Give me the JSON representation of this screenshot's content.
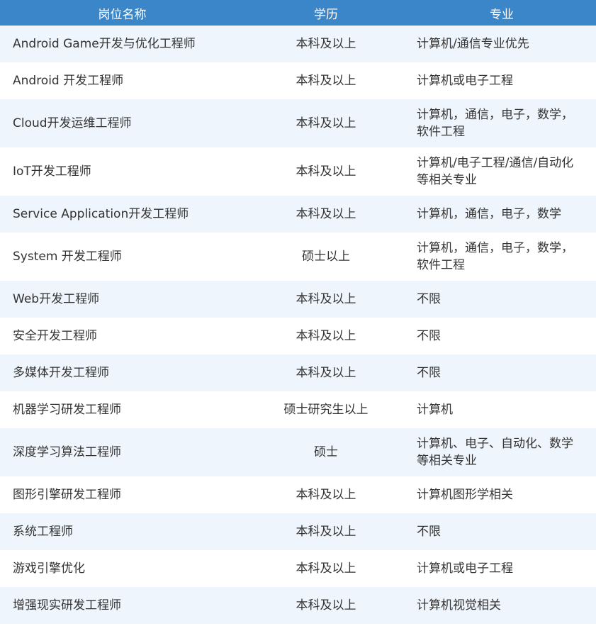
{
  "colors": {
    "header_bg": "#3a86c8",
    "header_text": "#ffffff",
    "row_odd_bg": "#eef5fc",
    "row_even_bg": "#ffffff",
    "body_text": "#333333"
  },
  "table": {
    "headers": [
      "岗位名称",
      "学历",
      "专业"
    ],
    "rows": [
      {
        "name": "Android Game开发与优化工程师",
        "education": "本科及以上",
        "major": "计算机/通信专业优先"
      },
      {
        "name": "Android 开发工程师",
        "education": "本科及以上",
        "major": "计算机或电子工程"
      },
      {
        "name": "Cloud开发运维工程师",
        "education": "本科及以上",
        "major": "计算机，通信，电子，数学，软件工程"
      },
      {
        "name": "IoT开发工程师",
        "education": "本科及以上",
        "major": "计算机/电子工程/通信/自动化等相关专业"
      },
      {
        "name": "Service Application开发工程师",
        "education": "本科及以上",
        "major": "计算机，通信，电子，数学"
      },
      {
        "name": "System 开发工程师",
        "education": "硕士以上",
        "major": "计算机，通信，电子，数学，软件工程"
      },
      {
        "name": "Web开发工程师",
        "education": "本科及以上",
        "major": "不限"
      },
      {
        "name": "安全开发工程师",
        "education": "本科及以上",
        "major": "不限"
      },
      {
        "name": "多媒体开发工程师",
        "education": "本科及以上",
        "major": "不限"
      },
      {
        "name": "机器学习研发工程师",
        "education": "硕士研究生以上",
        "major": "计算机"
      },
      {
        "name": "深度学习算法工程师",
        "education": "硕士",
        "major": "计算机、电子、自动化、数学等相关专业"
      },
      {
        "name": "图形引擎研发工程师",
        "education": "本科及以上",
        "major": "计算机图形学相关"
      },
      {
        "name": "系统工程师",
        "education": "本科及以上",
        "major": "不限"
      },
      {
        "name": "游戏引擎优化",
        "education": "本科及以上",
        "major": "计算机或电子工程"
      },
      {
        "name": "增强现实研发工程师",
        "education": "本科及以上",
        "major": "计算机视觉相关"
      }
    ]
  }
}
